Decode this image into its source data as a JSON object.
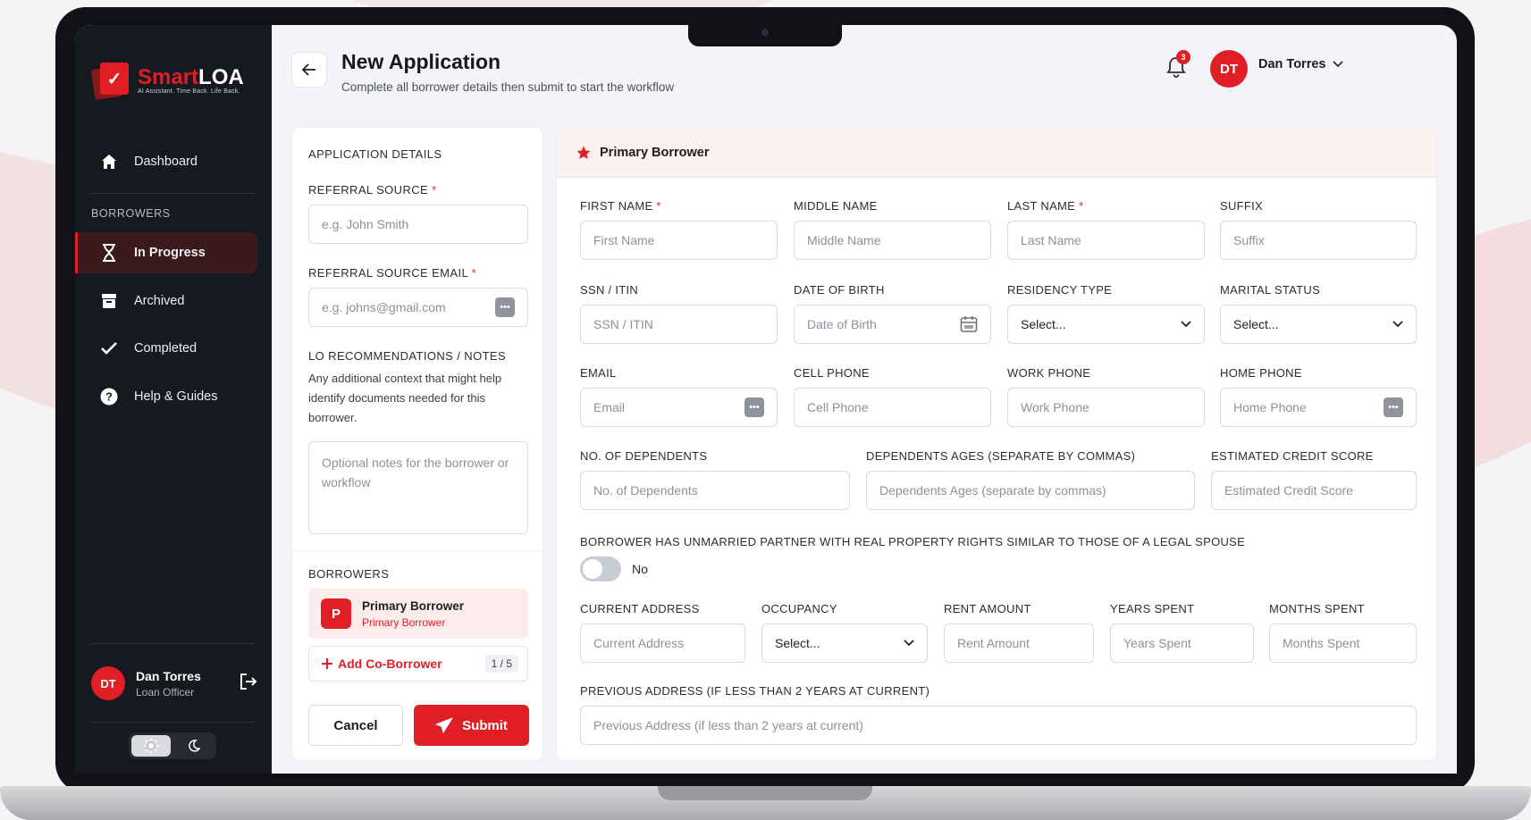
{
  "brand": {
    "name_red": "Smart",
    "name_white": "LOA",
    "tagline": "AI Assistant. Time Back. Life Back."
  },
  "sidebar": {
    "dashboard": "Dashboard",
    "section": "BORROWERS",
    "items": [
      {
        "label": "In Progress"
      },
      {
        "label": "Archived"
      },
      {
        "label": "Completed"
      },
      {
        "label": "Help & Guides"
      }
    ],
    "user": {
      "initials": "DT",
      "name": "Dan Torres",
      "role": "Loan Officer"
    }
  },
  "header": {
    "title": "New Application",
    "subtitle": "Complete all borrower details then submit to start the workflow",
    "notifications": "3",
    "user_initials": "DT",
    "user_name": "Dan Torres"
  },
  "application": {
    "section": "APPLICATION DETAILS",
    "referral_label": "REFERRAL SOURCE",
    "referral_placeholder": "e.g. John Smith",
    "referral_email_label": "REFERRAL SOURCE EMAIL",
    "referral_email_placeholder": "e.g. johns@gmail.com",
    "notes_label": "LO RECOMMENDATIONS / NOTES",
    "notes_help": "Any additional context that might help identify documents needed for this borrower.",
    "notes_placeholder": "Optional notes for the borrower or workflow",
    "borrowers_label": "BORROWERS",
    "borrower_initial": "P",
    "borrower_name": "Primary Borrower",
    "borrower_role": "Primary Borrower",
    "add_co": "Add Co-Borrower",
    "count": "1 / 5",
    "cancel": "Cancel",
    "submit": "Submit"
  },
  "form": {
    "title": "Primary Borrower",
    "required_mark": "*",
    "first_name": {
      "label": "FIRST NAME",
      "placeholder": "First Name"
    },
    "middle_name": {
      "label": "MIDDLE NAME",
      "placeholder": "Middle Name"
    },
    "last_name": {
      "label": "LAST NAME",
      "placeholder": "Last Name"
    },
    "suffix": {
      "label": "SUFFIX",
      "placeholder": "Suffix"
    },
    "ssn": {
      "label": "SSN / ITIN",
      "placeholder": "SSN / ITIN"
    },
    "dob": {
      "label": "DATE OF BIRTH",
      "placeholder": "Date of Birth"
    },
    "residency": {
      "label": "RESIDENCY TYPE",
      "value": "Select..."
    },
    "marital": {
      "label": "MARITAL STATUS",
      "value": "Select..."
    },
    "email": {
      "label": "EMAIL",
      "placeholder": "Email"
    },
    "cell": {
      "label": "CELL PHONE",
      "placeholder": "Cell Phone"
    },
    "work": {
      "label": "WORK PHONE",
      "placeholder": "Work Phone"
    },
    "home": {
      "label": "HOME PHONE",
      "placeholder": "Home Phone"
    },
    "dependents": {
      "label": "NO. OF DEPENDENTS",
      "placeholder": "No. of Dependents"
    },
    "dep_ages": {
      "label": "DEPENDENTS AGES (SEPARATE BY COMMAS)",
      "placeholder": "Dependents Ages (separate by commas)"
    },
    "credit": {
      "label": "ESTIMATED CREDIT SCORE",
      "placeholder": "Estimated Credit Score"
    },
    "partner": {
      "label": "BORROWER HAS UNMARRIED PARTNER WITH REAL PROPERTY RIGHTS SIMILAR TO THOSE OF A LEGAL SPOUSE",
      "value": "No"
    },
    "address": {
      "label": "CURRENT ADDRESS",
      "placeholder": "Current Address"
    },
    "occupancy": {
      "label": "OCCUPANCY",
      "value": "Select..."
    },
    "rent": {
      "label": "RENT AMOUNT",
      "placeholder": "Rent Amount"
    },
    "years": {
      "label": "YEARS SPENT",
      "placeholder": "Years Spent"
    },
    "months": {
      "label": "MONTHS SPENT",
      "placeholder": "Months Spent"
    },
    "prev_address": {
      "label": "PREVIOUS ADDRESS (IF LESS THAN 2 YEARS AT CURRENT)",
      "placeholder": "Previous Address (if less than 2 years at current)"
    }
  },
  "colors": {
    "accent": "#e01e25",
    "sidebar": "#16191f"
  },
  "icons": [
    "home-icon",
    "hourglass-icon",
    "archive-icon",
    "check-icon",
    "help-icon",
    "logout-icon",
    "sun-icon",
    "moon-icon",
    "back-arrow-icon",
    "bell-icon",
    "chevron-down-icon",
    "star-icon",
    "calendar-icon",
    "more-icon",
    "plus-icon",
    "send-icon"
  ]
}
